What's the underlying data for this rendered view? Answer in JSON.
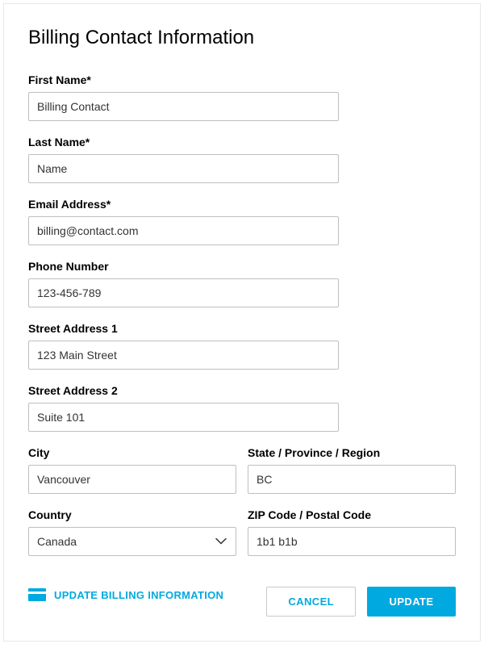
{
  "title": "Billing Contact Information",
  "fields": {
    "firstName": {
      "label": "First Name*",
      "value": "Billing Contact"
    },
    "lastName": {
      "label": "Last Name*",
      "value": "Name"
    },
    "email": {
      "label": "Email Address*",
      "value": "billing@contact.com"
    },
    "phone": {
      "label": "Phone Number",
      "value": "123-456-789"
    },
    "street1": {
      "label": "Street Address 1",
      "value": "123 Main Street"
    },
    "street2": {
      "label": "Street Address 2",
      "value": "Suite 101"
    },
    "city": {
      "label": "City",
      "value": "Vancouver"
    },
    "state": {
      "label": "State / Province / Region",
      "value": "BC"
    },
    "country": {
      "label": "Country",
      "value": "Canada"
    },
    "zip": {
      "label": "ZIP Code / Postal Code",
      "value": "1b1 b1b"
    }
  },
  "updateBillingLink": "UPDATE BILLING INFORMATION",
  "buttons": {
    "cancel": "CANCEL",
    "update": "UPDATE"
  }
}
